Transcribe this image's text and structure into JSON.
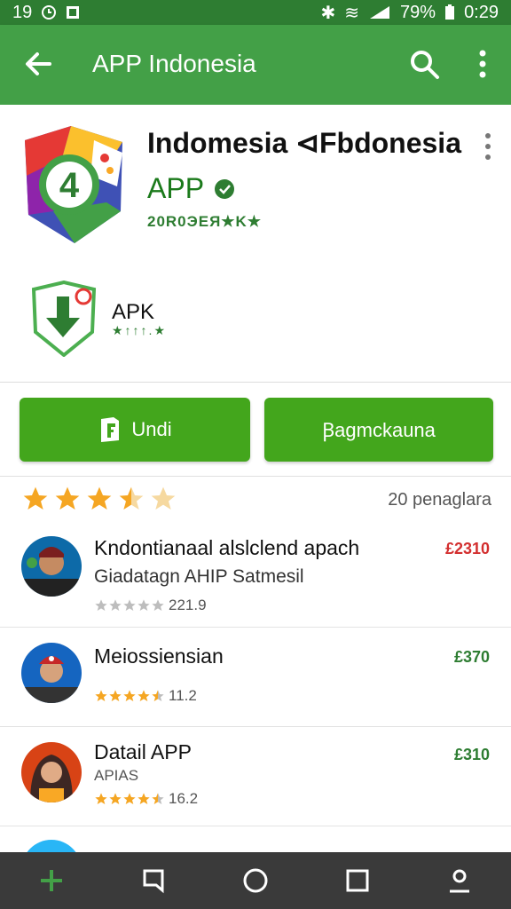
{
  "statusbar": {
    "left_text": "19",
    "battery": "79%",
    "time": "0:29"
  },
  "appbar": {
    "title": "APP Indonesia",
    "icons": [
      "back-arrow-icon",
      "search-icon",
      "more-vert-icon"
    ]
  },
  "hero": {
    "title": "Indomesia ⊲Fbdonesia",
    "subtitle": "APP",
    "meta": "20R0ЭEЯ★K★",
    "apk_label": "APK",
    "apk_meta": "★↑↑↑.★"
  },
  "buttons": {
    "primary_label": "Undi",
    "secondary_label": "Ꞵagmckauna"
  },
  "rating": {
    "stars": 3.5,
    "count_text": "20 penaglara"
  },
  "list": [
    {
      "title": "Kndontianaal alslclend apach",
      "subtitle": "Giadatagn AHIP Satmesil",
      "rating_text": "221.9",
      "price": "£2310",
      "price_color": "#d32f2f",
      "stars": 0
    },
    {
      "title": "Meiossiensian",
      "subtitle": "",
      "rating_text": "11.2",
      "price": "£370",
      "price_color": "#2e7d32",
      "stars": 4.5
    },
    {
      "title": "Datail APP",
      "subtitle": "APIAS",
      "rating_text": "16.2",
      "price": "£310",
      "price_color": "#2e7d32",
      "stars": 4.5
    }
  ],
  "navbar": {
    "icons": [
      "add-icon",
      "recent-apps-icon",
      "home-icon",
      "square-icon",
      "profile-icon"
    ]
  },
  "colors": {
    "appbar": "#43a047",
    "statusbar": "#2e7d32",
    "button": "#43a61c",
    "star": "#f5a623"
  }
}
